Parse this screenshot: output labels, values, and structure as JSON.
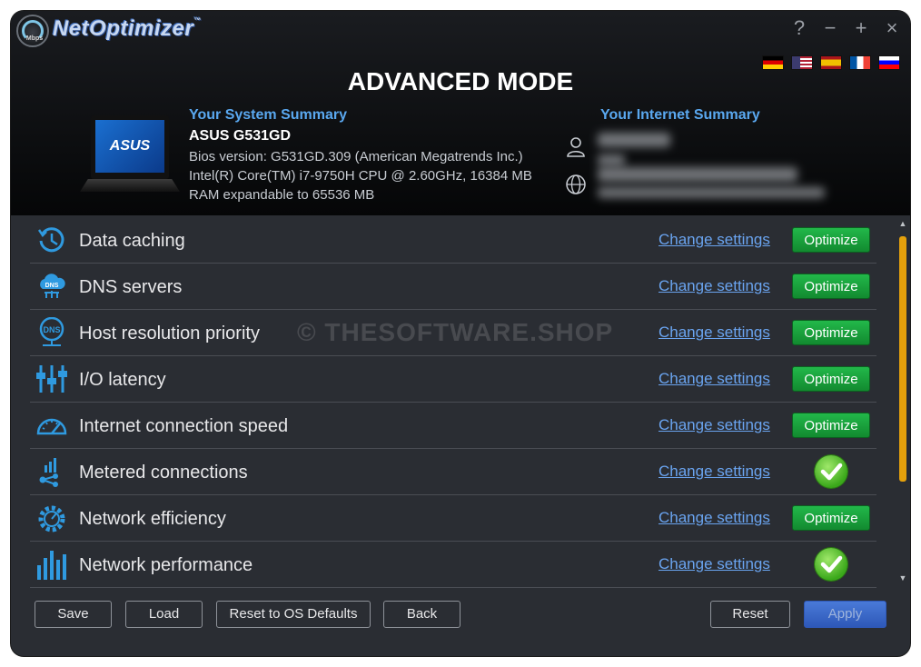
{
  "app": {
    "name": "NetOptimizer",
    "tm": "™",
    "gauge_label": "Mbps"
  },
  "window_buttons": [
    "?",
    "−",
    "+",
    "×"
  ],
  "flags": [
    "de-flag",
    "us-flag",
    "es-flag",
    "fr-flag",
    "si-flag"
  ],
  "title": "ADVANCED MODE",
  "system": {
    "heading": "Your System Summary",
    "model": "ASUS G531GD",
    "laptop_brand": "ASUS",
    "info": "Bios version: G531GD.309 (American Megatrends Inc.) Intel(R) Core(TM) i7-9750H CPU @ 2.60GHz, 16384 MB RAM expandable to 65536 MB"
  },
  "internet": {
    "heading": "Your Internet Summary"
  },
  "rows": [
    {
      "label": "Data caching",
      "link": "Change settings",
      "action": "Optimize",
      "done": false,
      "icon": "history-icon"
    },
    {
      "label": "DNS servers",
      "link": "Change settings",
      "action": "Optimize",
      "done": false,
      "icon": "dns-cloud-icon"
    },
    {
      "label": "Host resolution priority",
      "link": "Change settings",
      "action": "Optimize",
      "done": false,
      "icon": "dns-globe-icon"
    },
    {
      "label": "I/O latency",
      "link": "Change settings",
      "action": "Optimize",
      "done": false,
      "icon": "sliders-icon"
    },
    {
      "label": "Internet connection speed",
      "link": "Change settings",
      "action": "Optimize",
      "done": false,
      "icon": "speedometer-icon"
    },
    {
      "label": "Metered connections",
      "link": "Change settings",
      "action": "",
      "done": true,
      "icon": "share-chart-icon"
    },
    {
      "label": "Network efficiency",
      "link": "Change settings",
      "action": "Optimize",
      "done": false,
      "icon": "gear-gauge-icon"
    },
    {
      "label": "Network performance",
      "link": "Change settings",
      "action": "",
      "done": true,
      "icon": "bar-chart-icon"
    }
  ],
  "watermark": "© THESOFTWARE.SHOP",
  "buttons": {
    "save": "Save",
    "load": "Load",
    "reset_os": "Reset to OS Defaults",
    "back": "Back",
    "reset": "Reset",
    "apply": "Apply"
  },
  "colors": {
    "accent": "#5aa8f0",
    "optimize": "#1fa83f",
    "scrollbar": "#e5a10c",
    "apply": "#3a68c8"
  }
}
